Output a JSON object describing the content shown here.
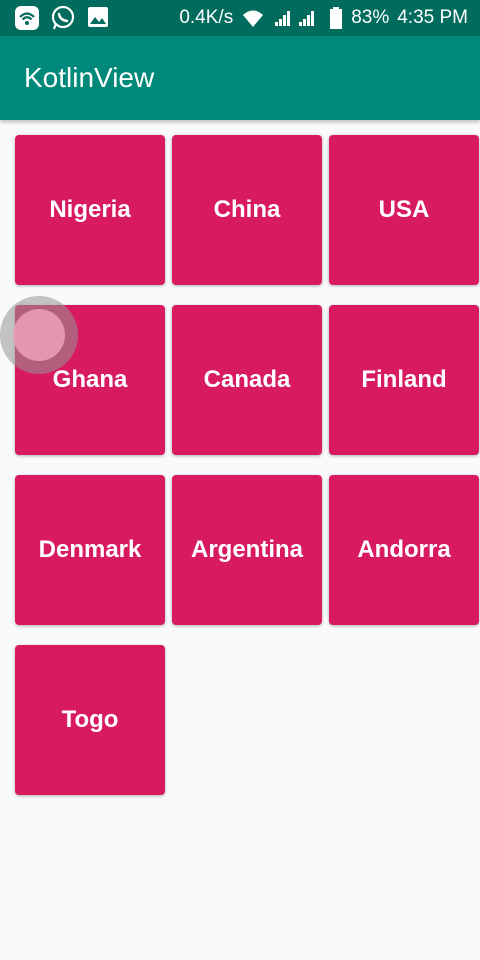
{
  "status_bar": {
    "left_icons": [
      "wifi-app-icon",
      "whatsapp-icon",
      "gallery-icon"
    ],
    "network_speed": "0.4K/s",
    "battery_percent": "83%",
    "time": "4:35 PM",
    "battery_level": 0.83
  },
  "app_bar": {
    "title": "KotlinView"
  },
  "countries": [
    {
      "label": "Nigeria"
    },
    {
      "label": "China"
    },
    {
      "label": "USA"
    },
    {
      "label": "Ghana"
    },
    {
      "label": "Canada"
    },
    {
      "label": "Finland"
    },
    {
      "label": "Denmark"
    },
    {
      "label": "Argentina"
    },
    {
      "label": "Andorra"
    },
    {
      "label": "Togo"
    }
  ],
  "colors": {
    "status_bar": "#016b5e",
    "app_bar": "#00897b",
    "tile": "#d81b60",
    "background": "#fafafa",
    "text_on_color": "#ffffff"
  }
}
